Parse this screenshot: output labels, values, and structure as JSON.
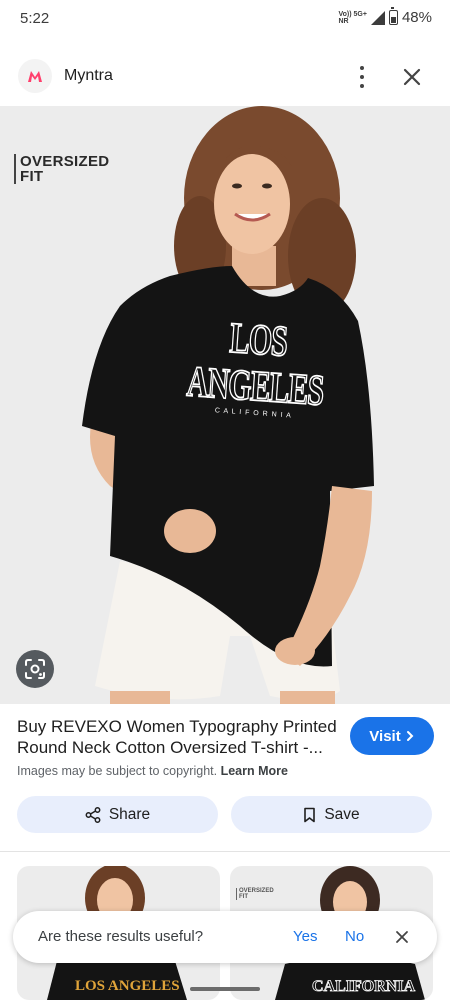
{
  "status_bar": {
    "time": "5:22",
    "network_top": "Vo)) 5G+",
    "network_bottom": "NR",
    "battery": "48%"
  },
  "header": {
    "site_name": "Myntra",
    "logo_letter": "M",
    "logo_color": "#ff3f6c",
    "more_icon": "more-vert-icon",
    "close_icon": "close-icon"
  },
  "hero": {
    "tag_line1": "OVERSIZED",
    "tag_line2": "FIT",
    "shirt_text": "LOS ANGELES",
    "shirt_subtext": "C A L I F O R N I A",
    "lens_icon": "lens-icon"
  },
  "result": {
    "title_line1": "Buy REVEXO Women Typography Printed",
    "title_line2": "Round Neck Cotton Oversized T-shirt -...",
    "visit_label": "Visit",
    "copyright_text": "Images may be subject to copyright.",
    "learn_more": "Learn More"
  },
  "actions": {
    "share_label": "Share",
    "save_label": "Save"
  },
  "related": {
    "thumb1_text": "LOS ANGELES",
    "thumb2_tag_line1": "OVERSIZED",
    "thumb2_tag_line2": "FIT",
    "thumb2_text": "CALIFORNIA"
  },
  "feedback": {
    "question": "Are these results useful?",
    "yes": "Yes",
    "no": "No"
  },
  "colors": {
    "accent": "#1a73e8",
    "button_bg": "#e8eefc",
    "brand": "#ff3f6c"
  }
}
